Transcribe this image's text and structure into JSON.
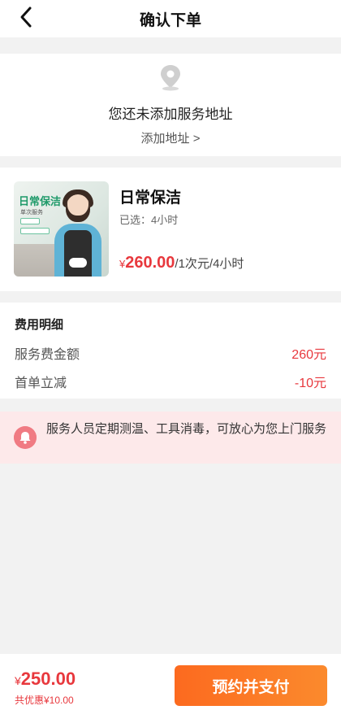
{
  "nav": {
    "title": "确认下单",
    "back_icon": "chevron-left-icon"
  },
  "address": {
    "icon": "location-pin-icon",
    "empty_text": "您还未添加服务地址",
    "add_link": "添加地址 >"
  },
  "product": {
    "thumb": {
      "title": "日常保洁",
      "subtitle": "单次服务"
    },
    "name": "日常保洁",
    "selected": "已选：4小时",
    "price_currency": "¥",
    "price_value": "260.00",
    "price_unit": "/1次元/4小时"
  },
  "fees": {
    "heading": "费用明细",
    "rows": [
      {
        "label": "服务费金额",
        "value": "260元"
      },
      {
        "label": "首单立减",
        "value": "-10元"
      }
    ]
  },
  "notice": {
    "icon": "bell-icon",
    "text": "服务人员定期测温、工具消毒，可放心为您上门服务"
  },
  "footer": {
    "total_currency": "¥",
    "total_value": "250.00",
    "discount": "共优惠¥10.00",
    "pay_button": "预约并支付"
  },
  "colors": {
    "accent_red": "#e8383d",
    "button_orange": "#fc6a1f",
    "notice_bg": "#fde9ea"
  }
}
